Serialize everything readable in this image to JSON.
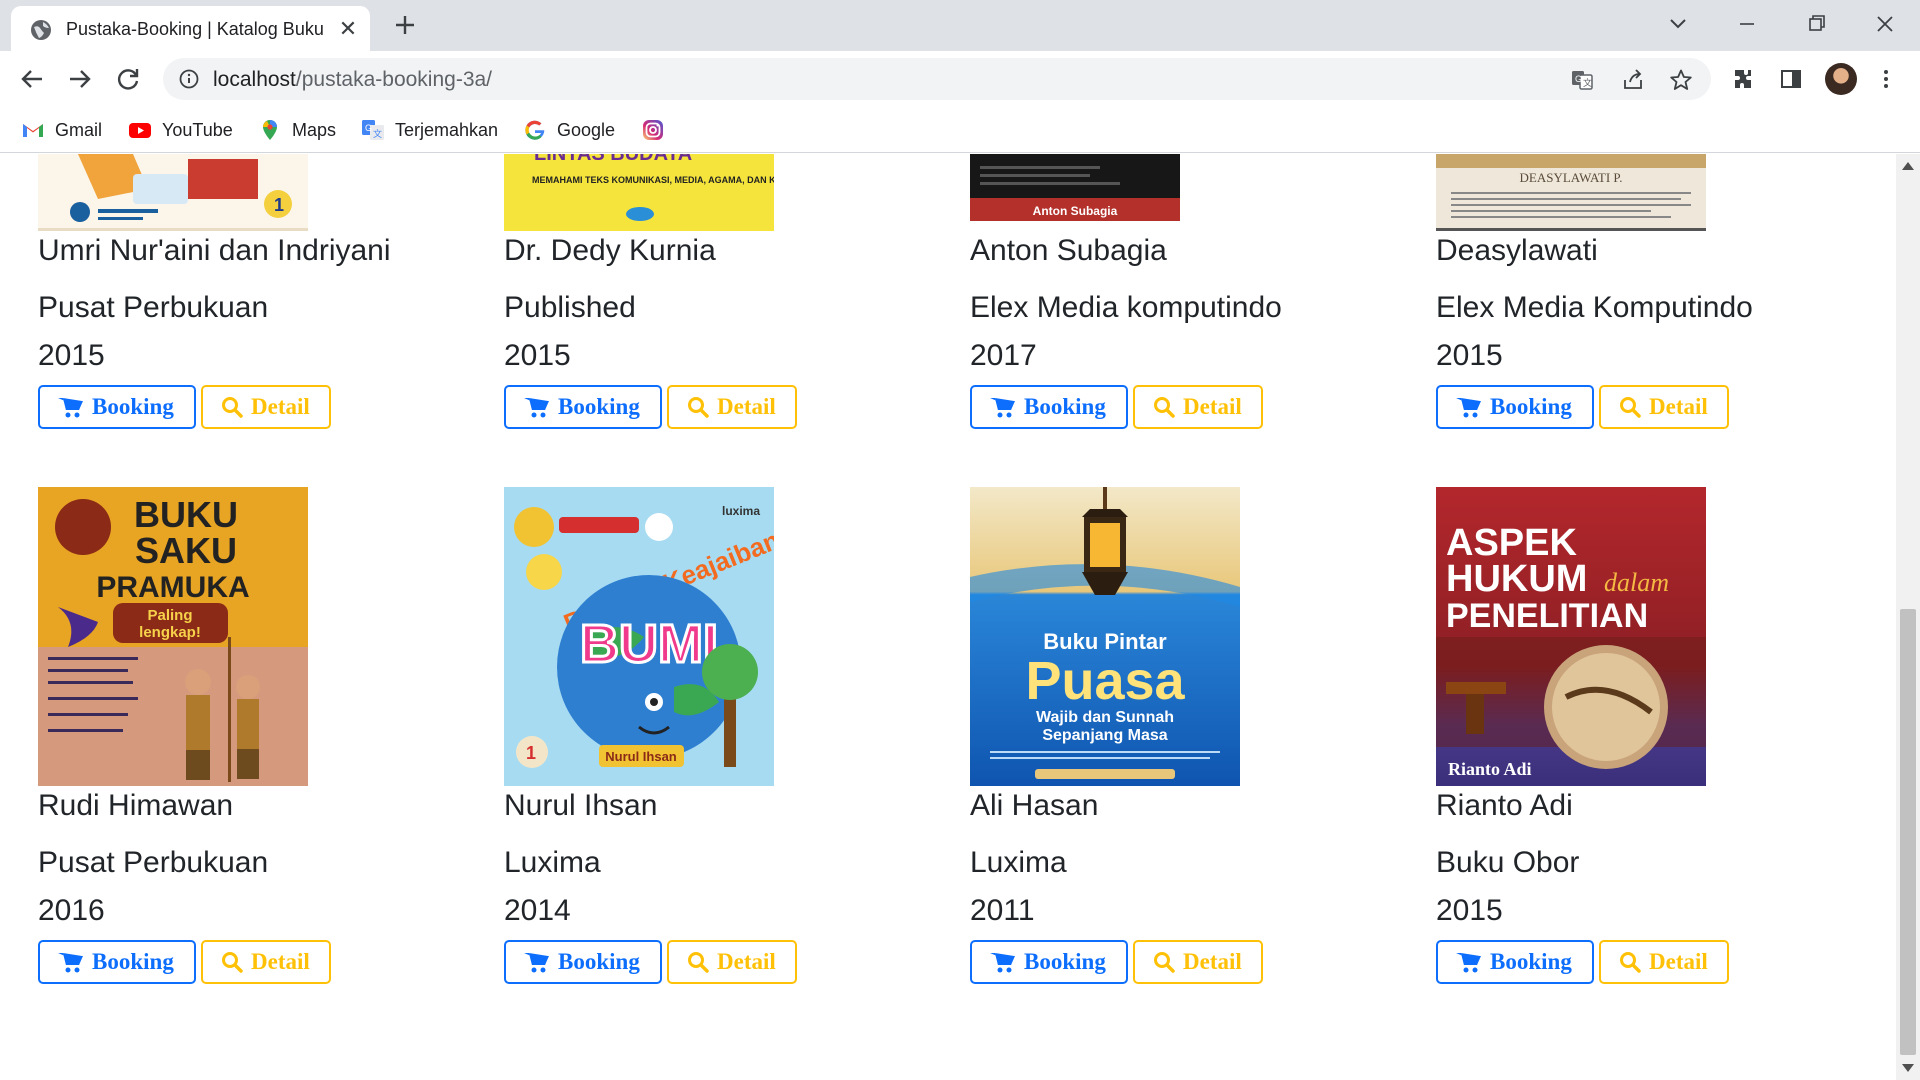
{
  "browser": {
    "tab_title": "Pustaka-Booking | Katalog Buku",
    "url_host": "localhost",
    "url_path": "/pustaka-booking-3a/",
    "bookmarks": [
      {
        "label": "Gmail",
        "icon": "gmail-icon"
      },
      {
        "label": "YouTube",
        "icon": "youtube-icon"
      },
      {
        "label": "Maps",
        "icon": "maps-icon"
      },
      {
        "label": "Terjemahkan",
        "icon": "translate-icon"
      },
      {
        "label": "Google",
        "icon": "google-icon"
      },
      {
        "label": "",
        "icon": "instagram-icon"
      }
    ]
  },
  "buttons": {
    "booking": "Booking",
    "detail": "Detail"
  },
  "books_row1": [
    {
      "author": "Umri Nur'aini dan Indriyani",
      "publisher": "Pusat Perbukuan",
      "year": "2015"
    },
    {
      "author": "Dr. Dedy Kurnia",
      "publisher": "Published",
      "year": "2015",
      "cover_text": "MEMAHAMI TEKS KOMUNIKASI, MEDIA, AGAMA, DAN KEBUDAYAAN INDONESIA"
    },
    {
      "author": "Anton Subagia",
      "publisher": "Elex Media komputindo",
      "year": "2017",
      "cover_text": "Anton Subagia"
    },
    {
      "author": "Deasylawati",
      "publisher": "Elex Media Komputindo",
      "year": "2015",
      "cover_text": "DEASYLAWATI P."
    }
  ],
  "books_row2": [
    {
      "author": "Rudi Himawan",
      "publisher": "Pusat Perbukuan",
      "year": "2016",
      "cover_title": "BUKU SAKU PRAMUKA",
      "cover_sub": "Paling lengkap!"
    },
    {
      "author": "Nurul Ihsan",
      "publisher": "Luxima",
      "year": "2014",
      "cover_title": "Rahasia Keajaiban BUMI",
      "cover_sub": "Nurul Ihsan"
    },
    {
      "author": "Ali Hasan",
      "publisher": "Luxima",
      "year": "2011",
      "cover_title": "Buku Pintar Puasa",
      "cover_sub": "Wajib dan Sunnah Sepanjang Masa"
    },
    {
      "author": "Rianto Adi",
      "publisher": "Buku Obor",
      "year": "2015",
      "cover_title": "ASPEK HUKUM dalam PENELITIAN",
      "cover_sub": "Rianto Adi"
    }
  ],
  "colors": {
    "booking": "#0d6efd",
    "detail": "#ffc107"
  }
}
